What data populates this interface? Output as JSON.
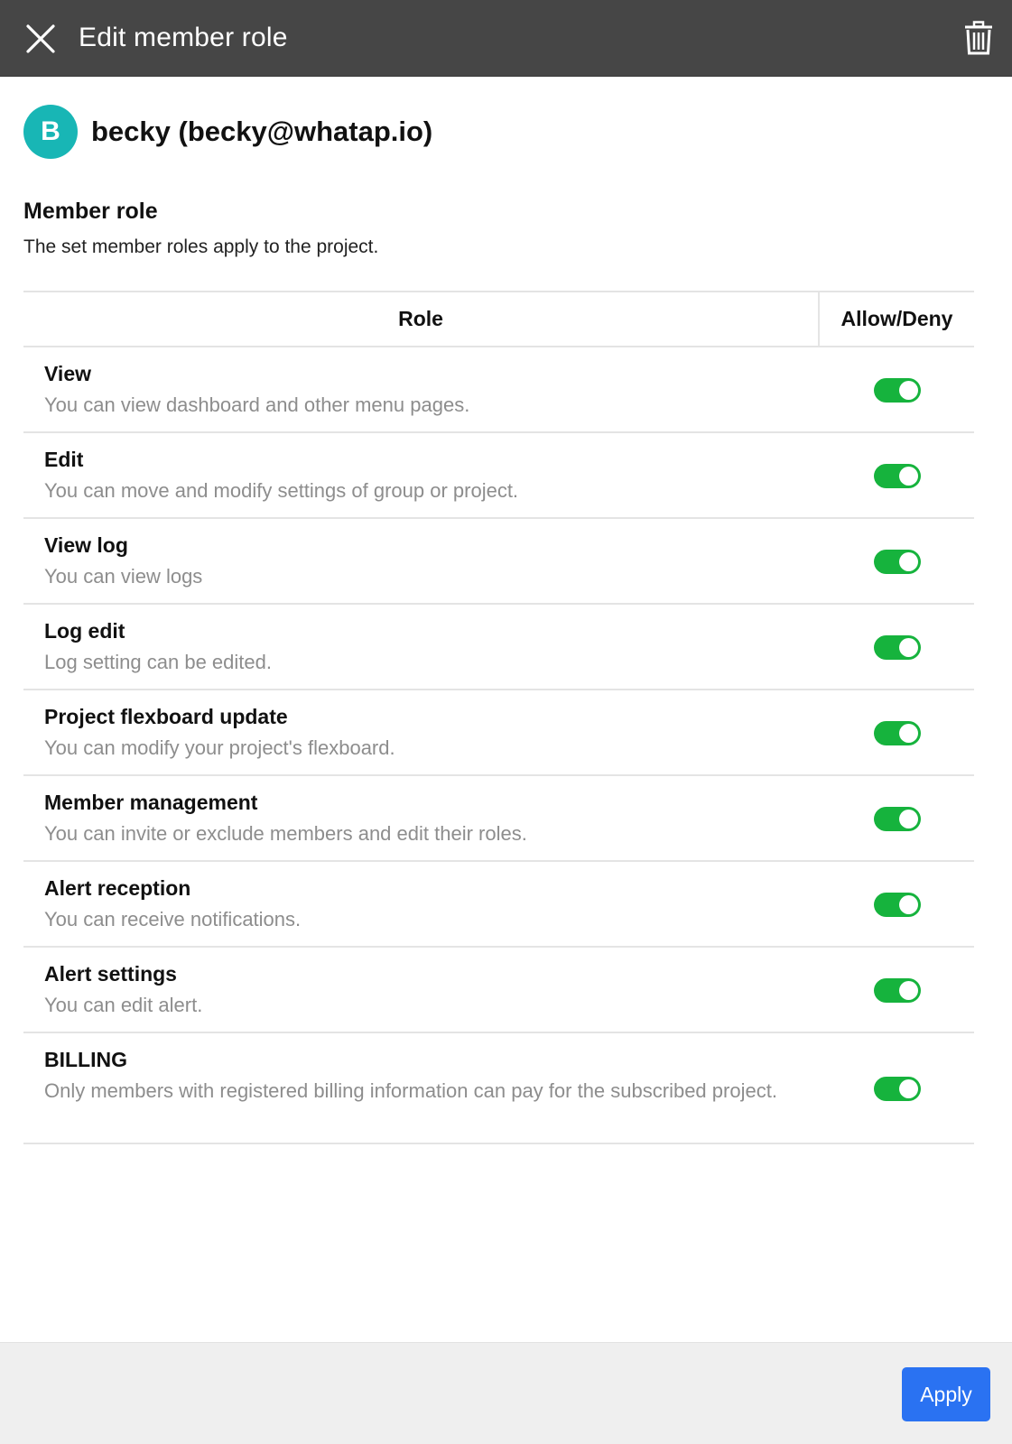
{
  "header": {
    "title": "Edit member role",
    "close_icon": "close-icon",
    "delete_icon": "trash-icon"
  },
  "user": {
    "avatar_initial": "B",
    "avatar_color": "#18b6b5",
    "name": "becky (becky@whatap.io)"
  },
  "section": {
    "title": "Member role",
    "description": "The set member roles apply to the project."
  },
  "table": {
    "headers": {
      "role": "Role",
      "allow_deny": "Allow/Deny"
    },
    "rows": [
      {
        "title": "View",
        "description": "You can view dashboard and other menu pages.",
        "enabled": true
      },
      {
        "title": "Edit",
        "description": "You can move and modify settings of group or project.",
        "enabled": true
      },
      {
        "title": "View log",
        "description": "You can view logs",
        "enabled": true
      },
      {
        "title": "Log edit",
        "description": "Log setting can be edited.",
        "enabled": true
      },
      {
        "title": "Project flexboard update",
        "description": "You can modify your project's flexboard.",
        "enabled": true
      },
      {
        "title": "Member management",
        "description": "You can invite or exclude members and edit their roles.",
        "enabled": true
      },
      {
        "title": "Alert reception",
        "description": "You can receive notifications.",
        "enabled": true
      },
      {
        "title": "Alert settings",
        "description": "You can edit alert.",
        "enabled": true
      },
      {
        "title": "BILLING",
        "description": "Only members with registered billing information can pay for the subscribed project.",
        "enabled": true
      }
    ]
  },
  "footer": {
    "apply_label": "Apply"
  },
  "colors": {
    "header_bg": "#464646",
    "toggle_on": "#16b33d",
    "apply_button": "#2a72f2",
    "footer_bg": "#efefef"
  }
}
